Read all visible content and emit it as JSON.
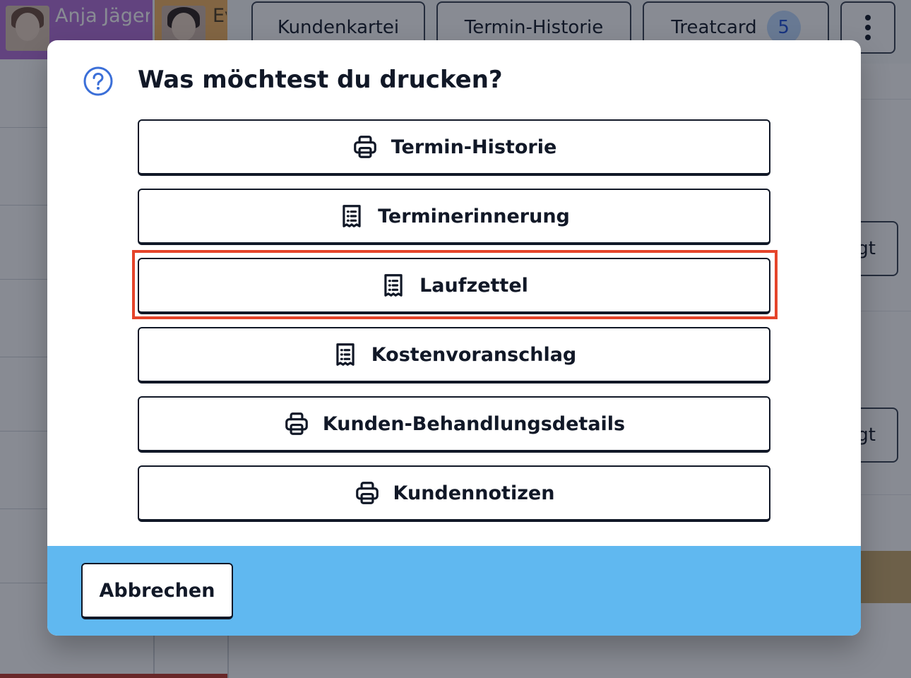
{
  "background": {
    "staff": [
      {
        "name": "Anja Jäger"
      },
      {
        "name": "Ev W"
      }
    ],
    "tabs": [
      {
        "label": "Kundenkartei"
      },
      {
        "label": "Termin-Historie"
      },
      {
        "label": "Treatcard",
        "badge": "5"
      }
    ],
    "more_icon": "kebab-menu-icon",
    "side_buttons": [
      {
        "label": "gt"
      },
      {
        "label": "gt"
      }
    ]
  },
  "modal": {
    "icon": "question-circle-icon",
    "title": "Was möchtest du drucken?",
    "options": [
      {
        "label": "Termin-Historie",
        "icon": "printer-icon"
      },
      {
        "label": "Terminerinnerung",
        "icon": "receipt-icon"
      },
      {
        "label": "Laufzettel",
        "icon": "receipt-icon",
        "highlighted": true
      },
      {
        "label": "Kostenvoranschlag",
        "icon": "receipt-icon"
      },
      {
        "label": "Kunden-Behandlungsdetails",
        "icon": "printer-icon"
      },
      {
        "label": "Kundennotizen",
        "icon": "printer-icon"
      }
    ],
    "cancel_label": "Abbrechen"
  },
  "colors": {
    "accent": "#3b6fd8",
    "footer": "#60b8f0",
    "highlight": "#e5442a",
    "staff_1": "#b36fd6",
    "staff_2": "#f2b35f"
  }
}
